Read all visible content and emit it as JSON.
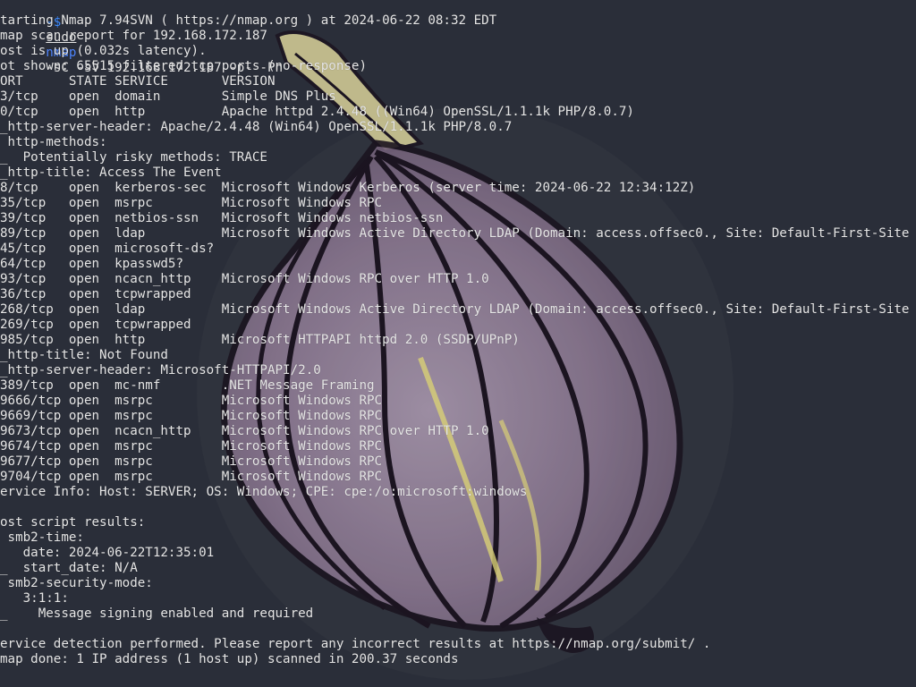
{
  "colors": {
    "background": "#2a2e39",
    "text": "#e6e6e6",
    "prompt_accent": "#3d8bff",
    "onion_outline": "#1b1420",
    "onion_fill": "#8f7c97"
  },
  "prompt": {
    "symbol": "-$",
    "sudo": "sudo",
    "program": "nmap",
    "args": "-sC -sV 192.168.172.187 -p- -Pn"
  },
  "lines": [
    "tarting Nmap 7.94SVN ( https://nmap.org ) at 2024-06-22 08:32 EDT",
    "map scan report for 192.168.172.187",
    "ost is up (0.032s latency).",
    "ot shown: 65515 filtered tcp ports (no-response)",
    "ORT      STATE SERVICE       VERSION",
    "3/tcp    open  domain        Simple DNS Plus",
    "0/tcp    open  http          Apache httpd 2.4.48 ((Win64) OpenSSL/1.1.1k PHP/8.0.7)",
    "_http-server-header: Apache/2.4.48 (Win64) OpenSSL/1.1.1k PHP/8.0.7",
    " http-methods:",
    "_  Potentially risky methods: TRACE",
    "_http-title: Access The Event",
    "8/tcp    open  kerberos-sec  Microsoft Windows Kerberos (server time: 2024-06-22 12:34:12Z)",
    "35/tcp   open  msrpc         Microsoft Windows RPC",
    "39/tcp   open  netbios-ssn   Microsoft Windows netbios-ssn",
    "89/tcp   open  ldap          Microsoft Windows Active Directory LDAP (Domain: access.offsec0., Site: Default-First-Site",
    "45/tcp   open  microsoft-ds?",
    "64/tcp   open  kpasswd5?",
    "93/tcp   open  ncacn_http    Microsoft Windows RPC over HTTP 1.0",
    "36/tcp   open  tcpwrapped",
    "268/tcp  open  ldap          Microsoft Windows Active Directory LDAP (Domain: access.offsec0., Site: Default-First-Site",
    "269/tcp  open  tcpwrapped",
    "985/tcp  open  http          Microsoft HTTPAPI httpd 2.0 (SSDP/UPnP)",
    "_http-title: Not Found",
    "_http-server-header: Microsoft-HTTPAPI/2.0",
    "389/tcp  open  mc-nmf        .NET Message Framing",
    "9666/tcp open  msrpc         Microsoft Windows RPC",
    "9669/tcp open  msrpc         Microsoft Windows RPC",
    "9673/tcp open  ncacn_http    Microsoft Windows RPC over HTTP 1.0",
    "9674/tcp open  msrpc         Microsoft Windows RPC",
    "9677/tcp open  msrpc         Microsoft Windows RPC",
    "9704/tcp open  msrpc         Microsoft Windows RPC",
    "ervice Info: Host: SERVER; OS: Windows; CPE: cpe:/o:microsoft:windows",
    "",
    "ost script results:",
    " smb2-time:",
    "   date: 2024-06-22T12:35:01",
    "_  start_date: N/A",
    " smb2-security-mode:",
    "   3:1:1:",
    "_    Message signing enabled and required",
    "",
    "ervice detection performed. Please report any incorrect results at https://nmap.org/submit/ .",
    "map done: 1 IP address (1 host up) scanned in 200.37 seconds"
  ],
  "wallpaper_icon": "onion-illustration"
}
